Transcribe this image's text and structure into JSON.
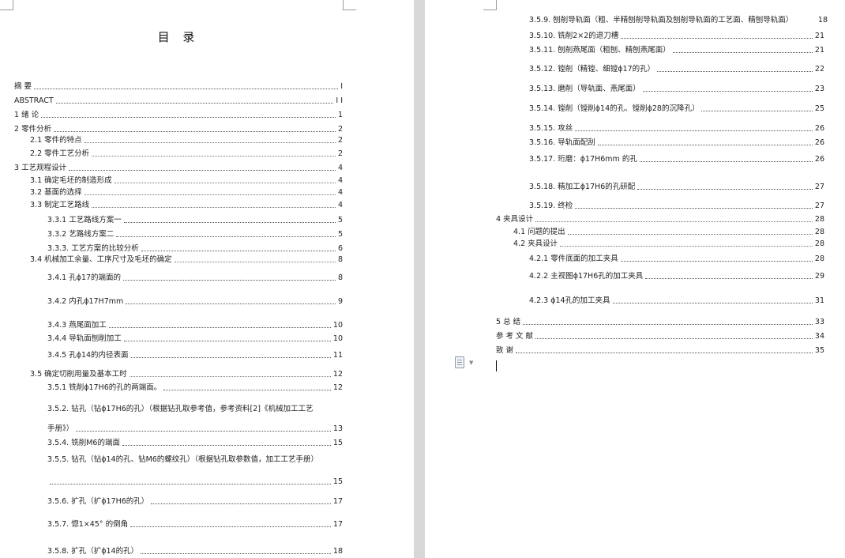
{
  "toc_title": "目 录",
  "left_entries": [
    {
      "label": "摘 要",
      "page": "I"
    },
    {
      "label": "ABSTRACT",
      "page": "I I"
    },
    {
      "label": "1 绪 论",
      "page": "1"
    },
    {
      "label": "2 零件分析",
      "page": "2"
    },
    {
      "label": "2.1 零件的特点",
      "page": "2"
    },
    {
      "label": "2.2 零件工艺分析",
      "page": "2"
    },
    {
      "label": "3 工艺规程设计",
      "page": "4"
    },
    {
      "label": "3.1 确定毛坯的制造形成",
      "page": "4"
    },
    {
      "label": "3.2 基面的选择",
      "page": "4"
    },
    {
      "label": "3.3 制定工艺路线",
      "page": "4"
    },
    {
      "label": "3.3.1 工艺路线方案一",
      "page": "5"
    },
    {
      "label": "3.3.2 艺路线方案二",
      "page": "5"
    },
    {
      "label": "3.3.3. 工艺方案的比较分析",
      "page": "6"
    },
    {
      "label": "3.4 机械加工余量、工序尺寸及毛坯的确定",
      "page": "8"
    },
    {
      "label": "3.4.1 孔ϕ17的端面的",
      "page": "8"
    },
    {
      "label": "3.4.2 内孔ϕ17H7mm",
      "page": "9"
    },
    {
      "label": "3.4.3 燕尾面加工",
      "page": "10"
    },
    {
      "label": "3.4.4 导轨面刨削加工",
      "page": "10"
    },
    {
      "label": "3.4.5 孔ϕ14的内径表面",
      "page": "11"
    },
    {
      "label": "3.5 确定切削用量及基本工时",
      "page": "12"
    },
    {
      "label": "3.5.1 铣削ϕ17H6的孔的两端面。",
      "page": "12"
    },
    {
      "label": "3.5.2. 钻孔（钻ϕ17H6的孔）（根据钻孔取参考值，参考资料[2]《机械加工工艺",
      "page": ""
    },
    {
      "label": "手册》）",
      "page": "13"
    },
    {
      "label": "3.5.4. 铣削M6的端面",
      "page": "15"
    },
    {
      "label": "3.5.5. 钻孔（钻ϕ14的孔、钻M6的螺纹孔）（根据钻孔取参数值，加工工艺手册）",
      "page": ""
    },
    {
      "label": "",
      "page": "15"
    },
    {
      "label": "3.5.6. 扩孔（扩ϕ17H6的孔）",
      "page": "17"
    },
    {
      "label": "3.5.7. 惚1×45° 的倒角",
      "page": "17"
    },
    {
      "label": "3.5.8. 扩孔（扩ϕ14的孔）",
      "page": "18"
    }
  ],
  "right_entries": [
    {
      "label": "3.5.9. 刨削导轨面（粗、半精刨削导轨面及刨削导轨面的工艺面、精刨导轨面）",
      "page": "18"
    },
    {
      "label": "3.5.10. 铣削2×2的退刀槽",
      "page": "21"
    },
    {
      "label": "3.5.11. 刨削燕尾面（粗刨、精刨燕尾面）",
      "page": "21"
    },
    {
      "label": "3.5.12. 镗削（精镗、细镗ϕ17的孔）",
      "page": "22"
    },
    {
      "label": "3.5.13. 磨削（导轨面、燕尾面）",
      "page": "23"
    },
    {
      "label": "3.5.14. 镗削（镗削ϕ14的孔、镗削ϕ28的沉降孔）",
      "page": "25"
    },
    {
      "label": "3.5.15. 攻丝",
      "page": "26"
    },
    {
      "label": "3.5.16. 导轨面配刮",
      "page": "26"
    },
    {
      "label": "3.5.17. 珩磨：ϕ17H6mm 的孔",
      "page": "26"
    },
    {
      "label": "3.5.18. 精加工ϕ17H6的孔研配",
      "page": "27"
    },
    {
      "label": "3.5.19. 终检",
      "page": "27"
    },
    {
      "label": "4 夹具设计",
      "page": "28"
    },
    {
      "label": "4.1 问题的提出",
      "page": "28"
    },
    {
      "label": "4.2 夹具设计",
      "page": "28"
    },
    {
      "label": "4.2.1 零件底面的加工夹具",
      "page": "28"
    },
    {
      "label": "4.2.2 主视图ϕ17H6孔的加工夹具",
      "page": "29"
    },
    {
      "label": "4.2.3 ϕ14孔的加工夹具",
      "page": "31"
    },
    {
      "label": "5 总 结",
      "page": "33"
    },
    {
      "label": "参 考 文 献",
      "page": "34"
    },
    {
      "label": "致 谢",
      "page": "35"
    }
  ]
}
